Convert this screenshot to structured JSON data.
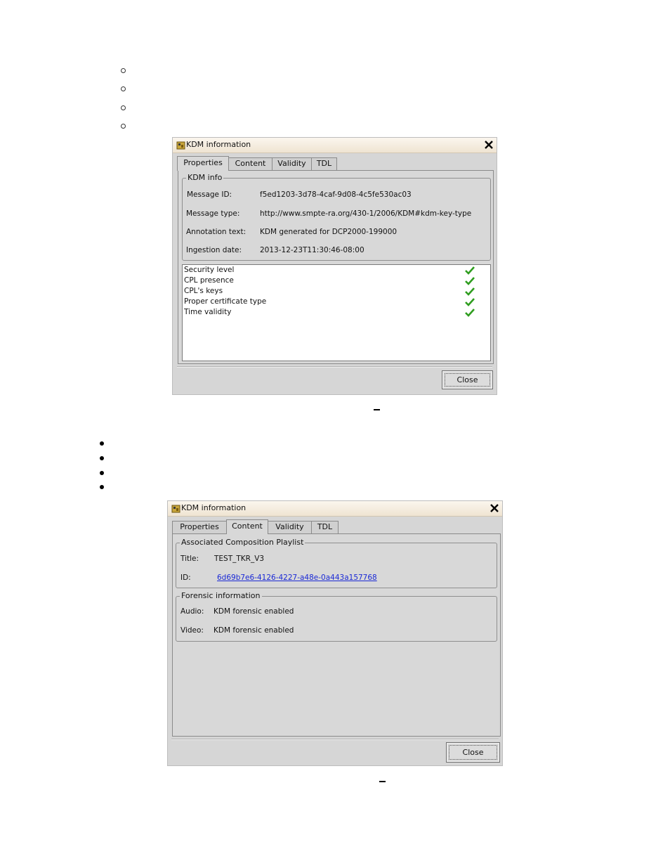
{
  "dialog1": {
    "title": "KDM information",
    "tabs": [
      "Properties",
      "Content",
      "Validity",
      "TDL"
    ],
    "kdm_info": {
      "legend": "KDM info",
      "rows": [
        {
          "label": "Message ID:",
          "value": "f5ed1203-3d78-4caf-9d08-4c5fe530ac03"
        },
        {
          "label": "Message type:",
          "value": "http://www.smpte-ra.org/430-1/2006/KDM#kdm-key-type"
        },
        {
          "label": "Annotation text:",
          "value": "KDM generated for DCP2000-199000"
        },
        {
          "label": "Ingestion date:",
          "value": "2013-12-23T11:30:46-08:00"
        }
      ]
    },
    "checks": [
      {
        "label": "Security level",
        "status": "ok"
      },
      {
        "label": "CPL presence",
        "status": "ok"
      },
      {
        "label": "CPL's keys",
        "status": "ok"
      },
      {
        "label": "Proper certificate type",
        "status": "ok"
      },
      {
        "label": "Time validity",
        "status": "ok"
      }
    ],
    "close_label": "Close"
  },
  "dialog2": {
    "title": "KDM information",
    "tabs": [
      "Properties",
      "Content",
      "Validity",
      "TDL"
    ],
    "cpl": {
      "legend": "Associated Composition Playlist",
      "title_label": "Title:",
      "title_value": "TEST_TKR_V3",
      "id_label": "ID:",
      "id_value": "6d69b7e6-4126-4227-a48e-0a443a157768"
    },
    "forensic": {
      "legend": "Forensic information",
      "audio_label": "Audio:",
      "audio_value": "KDM forensic enabled",
      "video_label": "Video:",
      "video_value": "KDM forensic enabled"
    },
    "close_label": "Close"
  },
  "colors": {
    "check": "#2f9d1f",
    "link": "#1a29d6",
    "dialog_bg": "#d6d6d6"
  }
}
